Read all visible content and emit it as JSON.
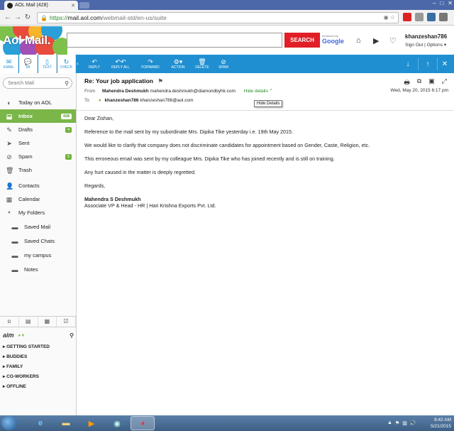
{
  "browser": {
    "tab_title": "AOL Mail (428)",
    "url_https": "https://",
    "url_host": "mail.aol.com",
    "url_path": "/webmail-std/en-us/suite"
  },
  "header": {
    "logo": "Aol Mail.",
    "search_button": "SEARCH",
    "enhanced_by": "enhanced by",
    "google": "Google",
    "username": "khanzeshan786",
    "sign_out": "Sign Out",
    "options": "Options ▾"
  },
  "left_toolbar": {
    "email": "EMAIL",
    "im": "IM",
    "text": "TEXT",
    "check": "CHECK"
  },
  "action_bar": {
    "reply": "REPLY",
    "reply_all": "REPLY ALL",
    "forward": "FORWARD",
    "action": "ACTION",
    "delete": "DELETE",
    "spam": "SPAM"
  },
  "sidebar": {
    "search_placeholder": "Search Mail",
    "items": [
      {
        "label": "Today on AOL"
      },
      {
        "label": "Inbox",
        "count": "428"
      },
      {
        "label": "Drafts",
        "count": "4"
      },
      {
        "label": "Sent"
      },
      {
        "label": "Spam",
        "count": "5"
      },
      {
        "label": "Trash"
      },
      {
        "label": "Contacts"
      },
      {
        "label": "Calendar"
      },
      {
        "label": "My Folders"
      },
      {
        "label": "Saved Mail"
      },
      {
        "label": "Saved Chats"
      },
      {
        "label": "my campus"
      },
      {
        "label": "Notes"
      }
    ]
  },
  "aim": {
    "logo": "aim",
    "groups": [
      "GETTING STARTED",
      "BUDDIES",
      "FAMILY",
      "CO-WORKERS",
      "OFFLINE"
    ]
  },
  "message": {
    "subject": "Re: Your job application",
    "from_label": "From",
    "from_name": "Mahendra Deshmukh",
    "from_email": "mahendra.deshmukh@diamondbyhk.com",
    "hide_details": "Hide details ⌃",
    "date": "Wed, May 20, 2015 6:17 pm",
    "to_label": "To",
    "to_name": "khanzeshan786",
    "to_email": "khanzeshan786@aol.com",
    "tooltip": "Hide Details",
    "body": [
      "Dear Zishan,",
      "Reference to the mail sent by my subordinate Mrs. Dipika Tike yesterday i.e. 19th May 2015.",
      "We would like to clarify that company does not discriminate candidates for appointment based on Gender, Caste, Religion, etc.",
      "This erroneous email was sent by my colleague Mrs. Dipika Tike who has joined recently and is still on training.",
      "Any hurt caused in the matter is deeply regretted.",
      "Regards,"
    ],
    "sig_name": "Mahendra S Deshmukh",
    "sig_title": "Associate VP & Head - HR  | Hari Krishna Exports Pvt. Ltd."
  },
  "taskbar": {
    "time": "8:42 AM",
    "date": "5/21/2015"
  }
}
